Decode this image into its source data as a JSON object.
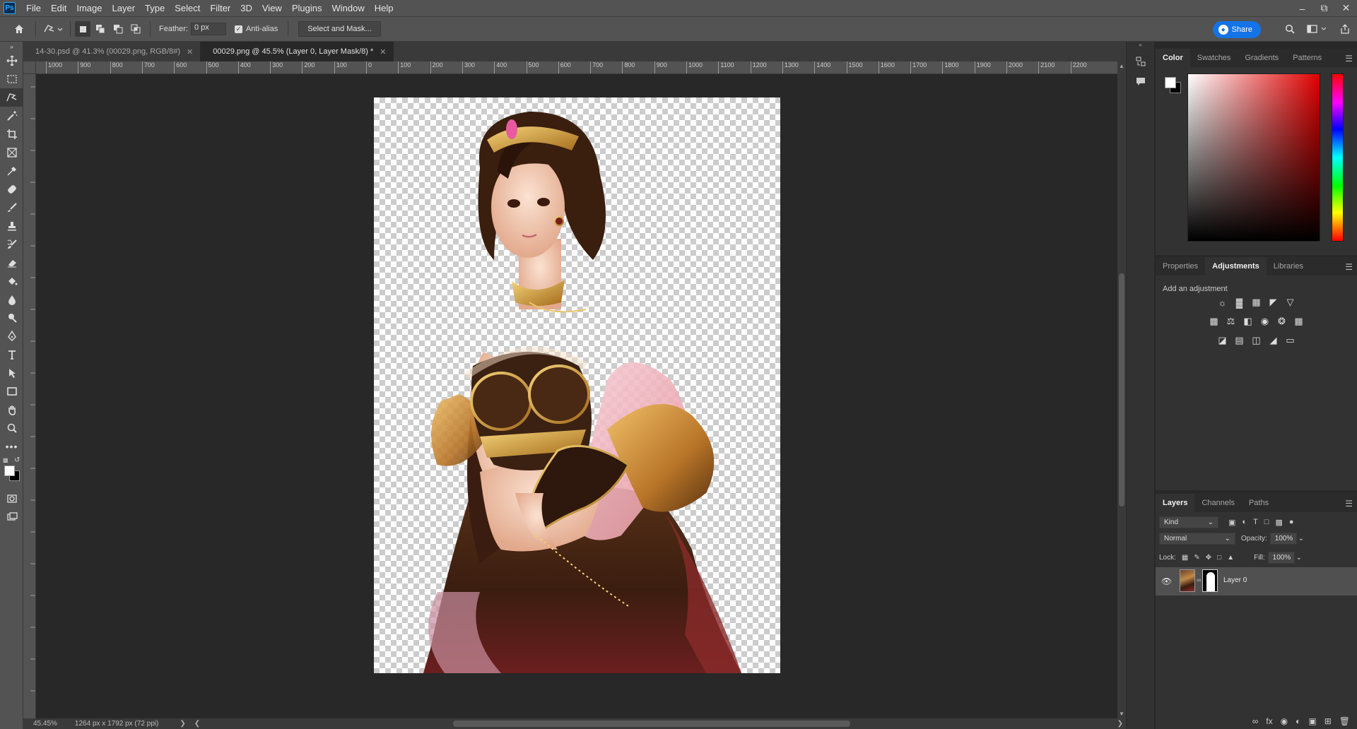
{
  "app": {
    "logo": "Ps"
  },
  "menu": [
    "File",
    "Edit",
    "Image",
    "Layer",
    "Type",
    "Select",
    "Filter",
    "3D",
    "View",
    "Plugins",
    "Window",
    "Help"
  ],
  "options_bar": {
    "feather_label": "Feather:",
    "feather_value": "0 px",
    "antialias_label": "Anti-alias",
    "antialias_checked": true,
    "select_mask_label": "Select and Mask...",
    "share_label": "Share"
  },
  "tabs": [
    {
      "label": "14-30.psd @ 41.3% (00029.png, RGB/8#)",
      "active": false
    },
    {
      "label": "00029.png @ 45.5% (Layer 0, Layer Mask/8) *",
      "active": true
    }
  ],
  "ruler_marks": [
    "1000",
    "900",
    "800",
    "700",
    "600",
    "500",
    "400",
    "300",
    "200",
    "100",
    "0",
    "100",
    "200",
    "300",
    "400",
    "500",
    "600",
    "700",
    "800",
    "900",
    "1000",
    "1100",
    "1200",
    "1300",
    "1400",
    "1500",
    "1600",
    "1700",
    "1800",
    "1900",
    "2000",
    "2100",
    "2200"
  ],
  "status": {
    "zoom": "45.45%",
    "dimensions": "1264 px x 1792 px (72 ppi)"
  },
  "color_panel": {
    "tabs": [
      "Color",
      "Swatches",
      "Gradients",
      "Patterns"
    ],
    "active": "Color",
    "foreground": "#ffffff",
    "background": "#000000",
    "hue": "#e00000"
  },
  "adjustments_panel": {
    "tabs": [
      "Properties",
      "Adjustments",
      "Libraries"
    ],
    "active": "Adjustments",
    "label": "Add an adjustment"
  },
  "layers_panel": {
    "tabs": [
      "Layers",
      "Channels",
      "Paths"
    ],
    "active": "Layers",
    "kind_filter": "Kind",
    "blend_mode": "Normal",
    "opacity_label": "Opacity:",
    "opacity_value": "100%",
    "lock_label": "Lock:",
    "fill_label": "Fill:",
    "fill_value": "100%",
    "layers": [
      {
        "name": "Layer 0",
        "visible": true
      }
    ]
  },
  "colors": {
    "accent": "#1473e6",
    "panel": "#323232",
    "chrome": "#535353",
    "canvas_bg": "#282828"
  }
}
